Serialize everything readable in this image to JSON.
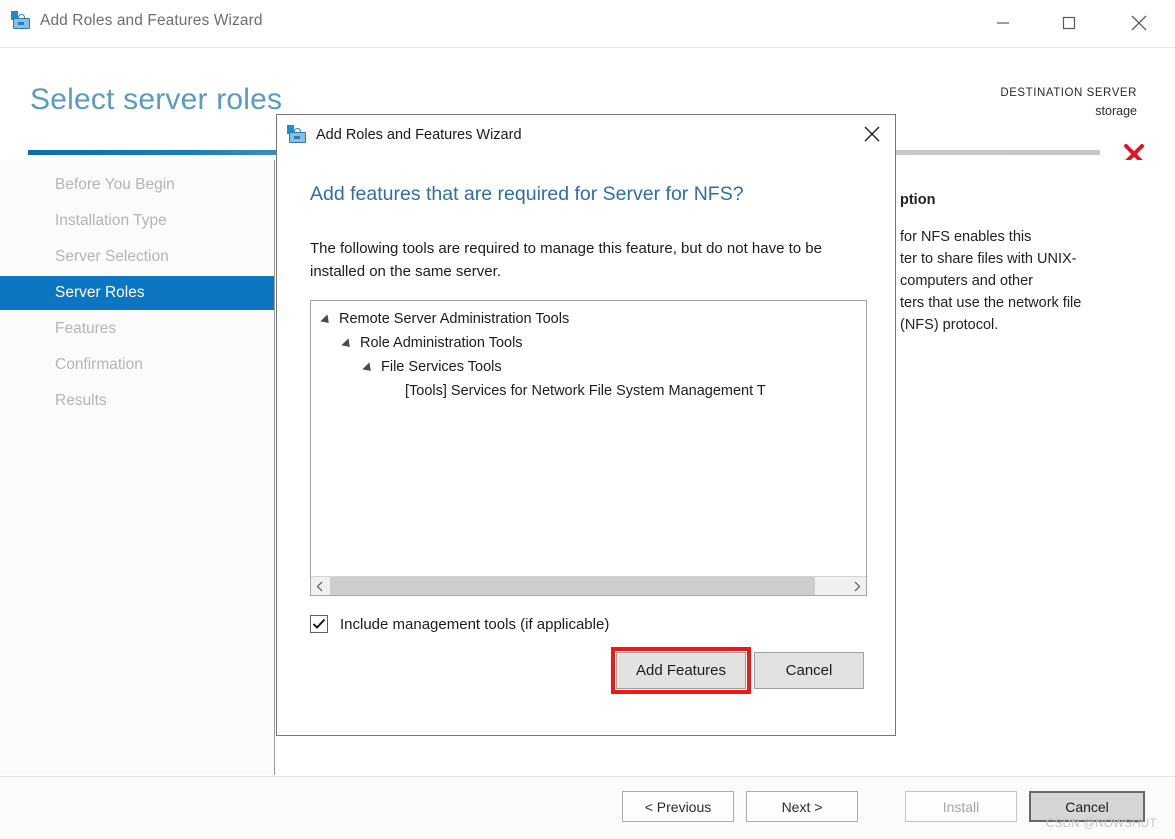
{
  "window": {
    "title": "Add Roles and Features Wizard",
    "icon": "wizard-toolbox-icon",
    "controls": {
      "minimize": "minimize-icon",
      "maximize": "maximize-icon",
      "close": "close-icon"
    }
  },
  "header": {
    "page_title": "Select server roles",
    "destination_label": "DESTINATION SERVER",
    "destination_value": "storage",
    "error_icon": "red-x-error-icon",
    "accent_color": "#0c76c2",
    "title_color": "#5a9bc4"
  },
  "sidebar": {
    "items": [
      {
        "label": "Before You Begin",
        "selected": false
      },
      {
        "label": "Installation Type",
        "selected": false
      },
      {
        "label": "Server Selection",
        "selected": false
      },
      {
        "label": "Server Roles",
        "selected": true
      },
      {
        "label": "Features",
        "selected": false
      },
      {
        "label": "Confirmation",
        "selected": false
      },
      {
        "label": "Results",
        "selected": false
      }
    ],
    "selected_bg": "#0c76c2"
  },
  "description_panel": {
    "title": "ption",
    "lines": [
      "for NFS enables this",
      "ter to share files with UNIX-",
      "computers and other",
      "ters that use the network file",
      " (NFS) protocol."
    ]
  },
  "dialog": {
    "title": "Add Roles and Features Wizard",
    "icon": "wizard-toolbox-icon",
    "close_icon": "close-icon",
    "heading": "Add features that are required for Server for NFS?",
    "body": "The following tools are required to manage this feature, but do not have to be installed on the same server.",
    "tree": [
      {
        "label": "Remote Server Administration Tools",
        "level": 0,
        "expanded": true
      },
      {
        "label": "Role Administration Tools",
        "level": 1,
        "expanded": true
      },
      {
        "label": "File Services Tools",
        "level": 2,
        "expanded": true
      },
      {
        "label": "[Tools] Services for Network File System Management T",
        "level": 3,
        "expanded": false
      }
    ],
    "checkbox": {
      "label": "Include management tools (if applicable)",
      "checked": true
    },
    "buttons": {
      "add_features": "Add Features",
      "cancel": "Cancel"
    },
    "highlight_color": "#f41515"
  },
  "footer": {
    "previous": "< Previous",
    "next": "Next >",
    "install": "Install",
    "cancel": "Cancel"
  },
  "watermark": "CSDN @NOWSHUT"
}
